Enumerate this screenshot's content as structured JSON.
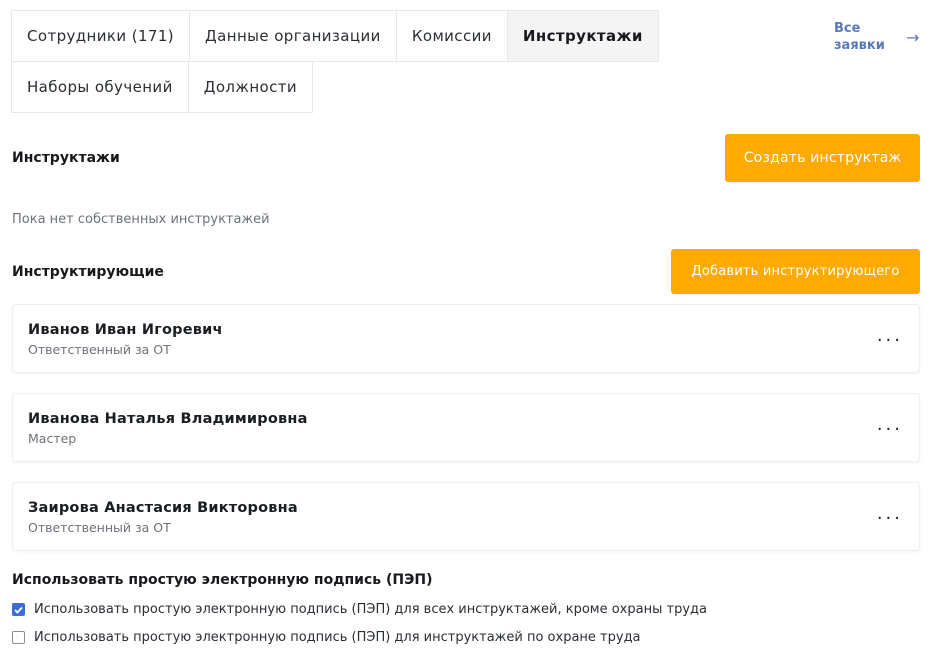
{
  "tabs": [
    {
      "label": "Сотрудники (171)",
      "active": false
    },
    {
      "label": "Данные организации",
      "active": false
    },
    {
      "label": "Комиссии",
      "active": false
    },
    {
      "label": "Инструктажи",
      "active": true
    },
    {
      "label": "Наборы обучений",
      "active": false
    },
    {
      "label": "Должности",
      "active": false
    }
  ],
  "header_link": {
    "label": "Все заявки",
    "icon": "arrow-right-icon"
  },
  "briefings": {
    "title": "Инструктажи",
    "create_button": "Создать инструктаж",
    "empty_text": "Пока нет собственных инструктажей"
  },
  "instructors": {
    "title": "Инструктирующие",
    "add_button": "Добавить инструктирующего",
    "items": [
      {
        "name": "Иванов Иван Игоревич",
        "role": "Ответственный за ОТ",
        "menu": "..."
      },
      {
        "name": "Иванова Наталья Владимировна",
        "role": "Мастер",
        "menu": "..."
      },
      {
        "name": "Заирова Анастасия Викторовна",
        "role": "Ответственный за ОТ",
        "menu": "..."
      }
    ]
  },
  "pep": {
    "title": "Использовать простую электронную подпись (ПЭП)",
    "options": [
      {
        "label": "Использовать простую электронную подпись (ПЭП) для всех инструктажей, кроме охраны труда",
        "checked": true
      },
      {
        "label": "Использовать простую электронную подпись (ПЭП) для инструктажей по охране труда",
        "checked": false
      }
    ]
  },
  "colors": {
    "accent": "#ffaa00",
    "link": "#5a79b5",
    "checkbox": "#3b6fd1"
  }
}
